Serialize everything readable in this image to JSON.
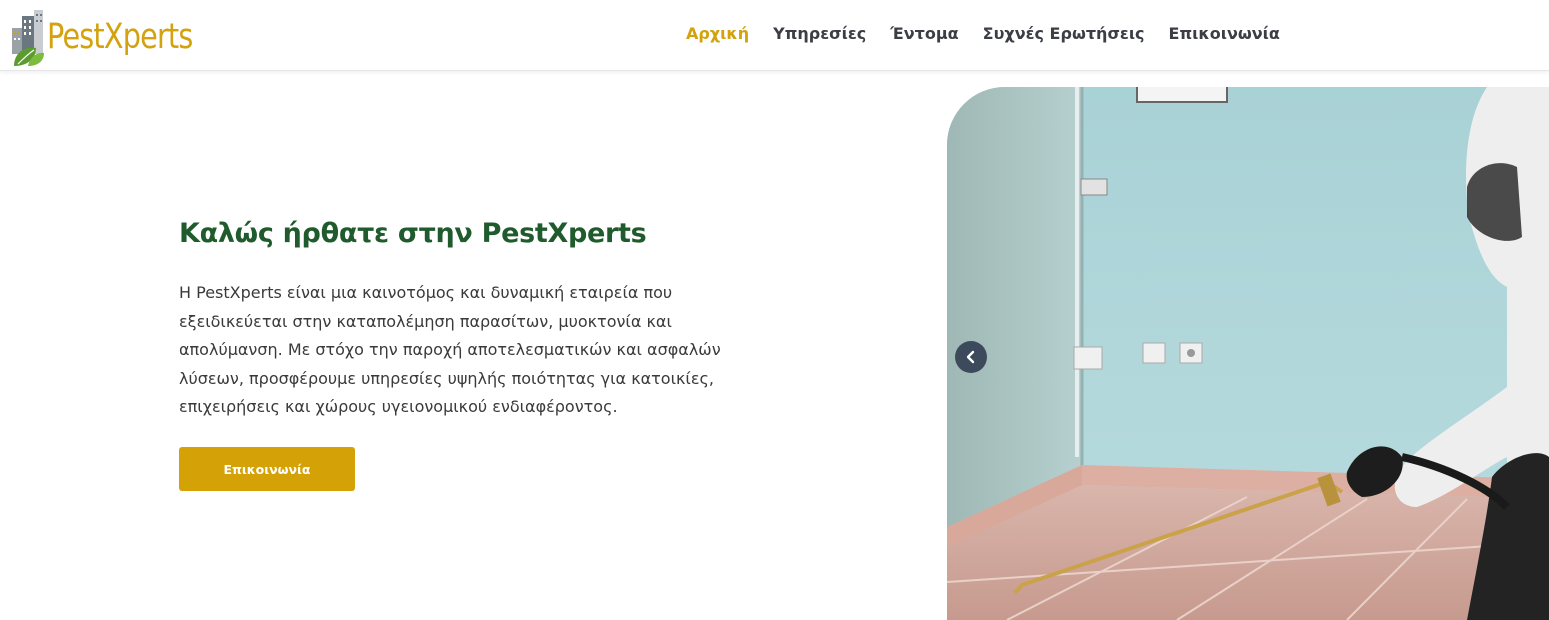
{
  "brand": {
    "name": "PestXperts",
    "accent_color": "#d3a20c"
  },
  "nav": {
    "items": [
      {
        "label": "Αρχική",
        "active": true
      },
      {
        "label": "Υπηρεσίες",
        "active": false
      },
      {
        "label": "Έντομα",
        "active": false
      },
      {
        "label": "Συχνές Ερωτήσεις",
        "active": false
      },
      {
        "label": "Επικοινωνία",
        "active": false
      }
    ]
  },
  "hero": {
    "title": "Καλώς ήρθατε στην PestXperts",
    "lines": [
      "Η PestXperts είναι μια καινοτόμος και δυναμική εταιρεία που",
      "εξειδικεύεται στην καταπολέμηση παρασίτων, μυοκτονία και",
      "απολύμανση. Με στόχο την παροχή αποτελεσματικών και ασφαλών",
      "λύσεων, προσφέρουμε υπηρεσίες υψηλής ποιότητας για κατοικίες,",
      "επιχειρήσεις και χώρους υγειονομικού ενδιαφέροντος."
    ],
    "cta_label": "Επικοινωνία",
    "title_color": "#1f5b2c"
  },
  "slider": {
    "prev_icon": "chevron-left-icon"
  }
}
